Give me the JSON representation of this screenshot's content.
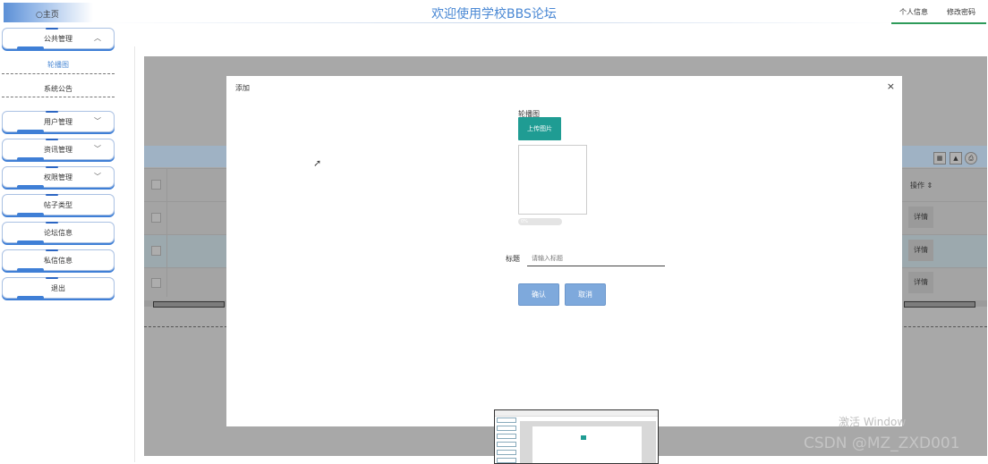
{
  "header": {
    "home_label": "主页",
    "title": "欢迎使用学校BBS论坛",
    "nav": [
      "个人信息",
      "修改密码"
    ]
  },
  "sidebar": {
    "group_open": {
      "label": "公共管理",
      "icon": "chevron-up-icon"
    },
    "sub_items": [
      {
        "label": "轮播图",
        "active": true
      },
      {
        "label": "系统公告",
        "active": false
      }
    ],
    "items": [
      {
        "label": "用户管理",
        "has_chevron": true
      },
      {
        "label": "资讯管理",
        "has_chevron": true
      },
      {
        "label": "权限管理",
        "has_chevron": true
      },
      {
        "label": "帖子类型",
        "has_chevron": false
      },
      {
        "label": "论坛信息",
        "has_chevron": false
      },
      {
        "label": "私信信息",
        "has_chevron": false
      },
      {
        "label": "退出",
        "has_chevron": false
      }
    ]
  },
  "table": {
    "op_header": "操作 ⇕",
    "rows": [
      {
        "action": "详情"
      },
      {
        "action": "详情"
      },
      {
        "action": "详情"
      }
    ]
  },
  "modal": {
    "title": "添加",
    "close": "×",
    "image_label": "轮播图",
    "upload_label": "上传图片",
    "progress": {
      "percent": 0,
      "text": "0%"
    },
    "title_label": "标题",
    "title_placeholder": "请输入标题",
    "confirm_label": "确认",
    "cancel_label": "取消"
  },
  "watermarks": {
    "windows": "激活 Window",
    "csdn": "CSDN @MZ_ZXD001"
  },
  "colors": {
    "accent": "#4a88d4",
    "upload_btn": "#1f9c93",
    "action_btn": "#7ea9dc"
  }
}
